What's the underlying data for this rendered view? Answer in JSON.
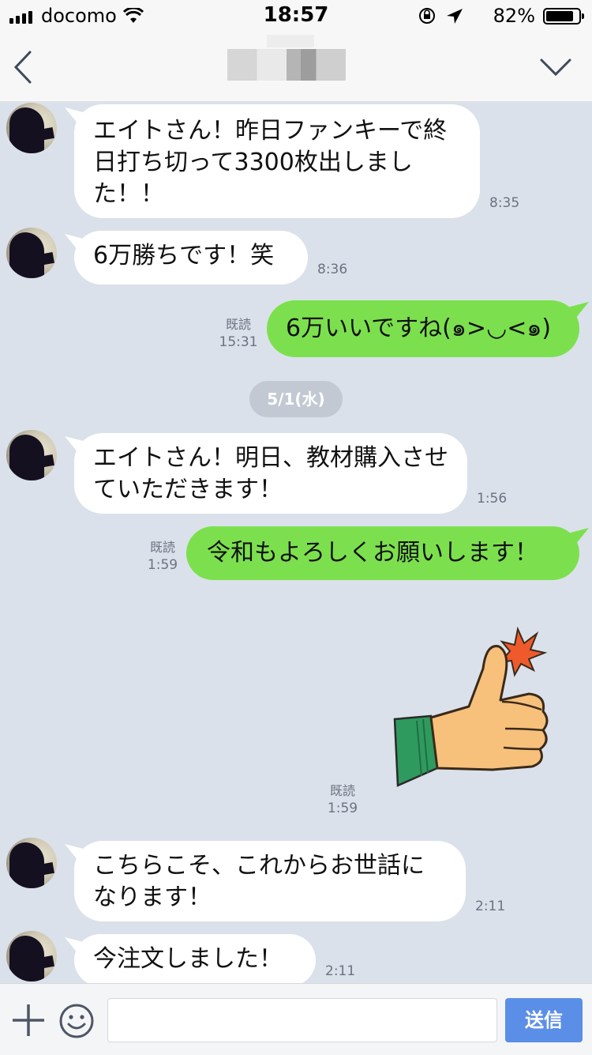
{
  "status_bar": {
    "carrier": "docomo",
    "time": "18:57",
    "battery_percent": "82%",
    "battery_level": 0.82
  },
  "header": {
    "title": "",
    "back_icon": "chevron-left-icon",
    "menu_icon": "chevron-down-icon"
  },
  "messages": [
    {
      "side": "in",
      "text": "エイトさん！昨日ファンキーで終日打ち切って3300枚出しました！！",
      "time": "8:35"
    },
    {
      "side": "in",
      "text": "6万勝ちです！笑",
      "time": "8:36"
    },
    {
      "side": "out",
      "text": "6万いいですね(๑>◡<๑)",
      "read": "既読",
      "time": "15:31"
    },
    {
      "side": "in",
      "text": "エイトさん！明日、教材購入させていただきます！",
      "time": "1:56"
    },
    {
      "side": "out",
      "text": "令和もよろしくお願いします！",
      "read": "既読",
      "time": "1:59"
    },
    {
      "side": "out",
      "sticker": "thumbs-up-sticker",
      "read": "既読",
      "time": "1:59"
    },
    {
      "side": "in",
      "text": "こちらこそ、これからお世話になります！",
      "time": "2:11"
    },
    {
      "side": "in",
      "text": "今注文しました！",
      "time": "2:11"
    }
  ],
  "date_separator": "5/1(水)",
  "composer": {
    "placeholder": "",
    "send_label": "送信",
    "add_icon": "plus-icon",
    "emoji_icon": "smile-icon"
  },
  "colors": {
    "chat_background": "#dbe1ea",
    "outgoing_bubble": "#7ce04e",
    "incoming_bubble": "#ffffff",
    "send_button": "#5b8ee6"
  }
}
